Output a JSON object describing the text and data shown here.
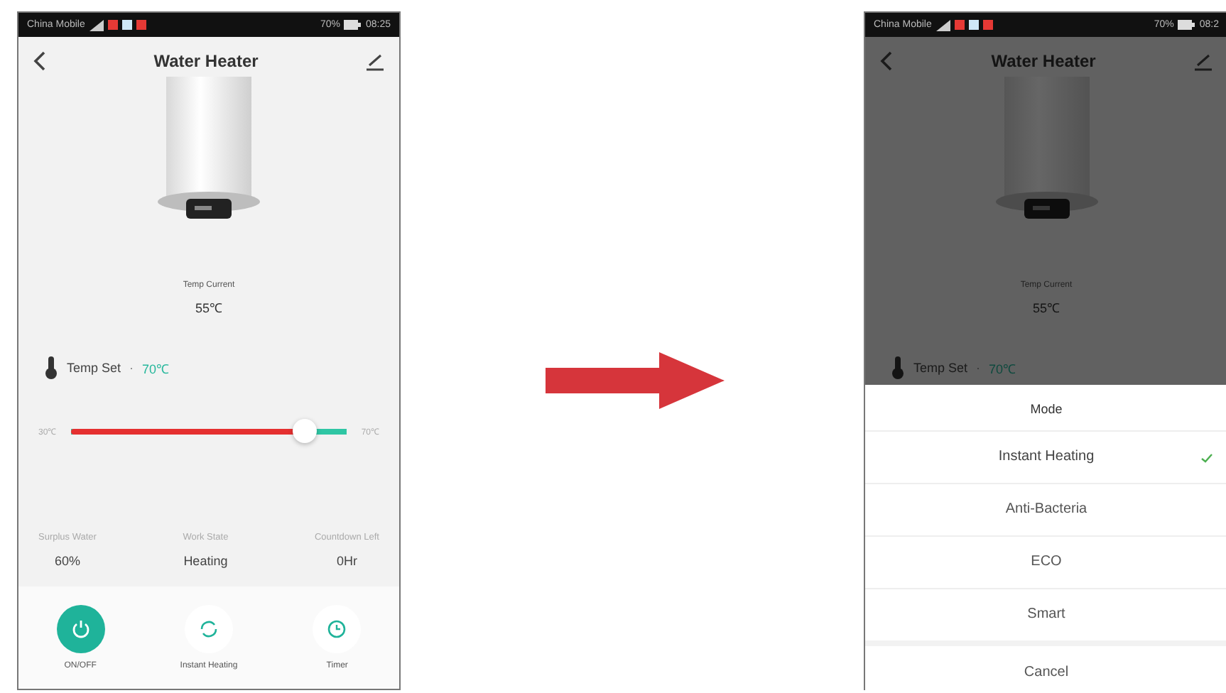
{
  "left_phone": {
    "status_bar": {
      "carrier": "China Mobile",
      "battery": "70%",
      "time": "08:25"
    },
    "title": "Water Heater",
    "temp_current": {
      "label": "Temp Current",
      "value": "55℃"
    },
    "temp_set": {
      "label": "Temp Set",
      "separator": "·",
      "value": "70℃"
    },
    "slider": {
      "min_label": "30℃",
      "max_label": "70℃",
      "level": 0.85
    },
    "stats": [
      {
        "label": "Surplus Water",
        "value": "60%"
      },
      {
        "label": "Work State",
        "value": "Heating"
      },
      {
        "label": "Countdown Left",
        "value": "0Hr"
      }
    ],
    "actions": [
      {
        "kind": "power",
        "label": "ON/OFF",
        "on": true
      },
      {
        "kind": "mode",
        "label": "Instant Heating",
        "on": false
      },
      {
        "kind": "timer",
        "label": "Timer",
        "on": false
      }
    ]
  },
  "right_phone": {
    "status_bar": {
      "carrier": "China Mobile",
      "battery": "70%",
      "time": "08:2"
    },
    "title": "Water Heater",
    "temp_current": {
      "label": "Temp Current",
      "value": "55℃"
    },
    "temp_set": {
      "label": "Temp Set",
      "separator": "·",
      "value": "70℃"
    },
    "dimmed": true,
    "mode_sheet": {
      "title": "Mode",
      "options": [
        {
          "label": "Instant Heating",
          "selected": true
        },
        {
          "label": "Anti-Bacteria",
          "selected": false
        },
        {
          "label": "ECO",
          "selected": false
        },
        {
          "label": "Smart",
          "selected": false
        }
      ],
      "cancel": "Cancel"
    }
  }
}
